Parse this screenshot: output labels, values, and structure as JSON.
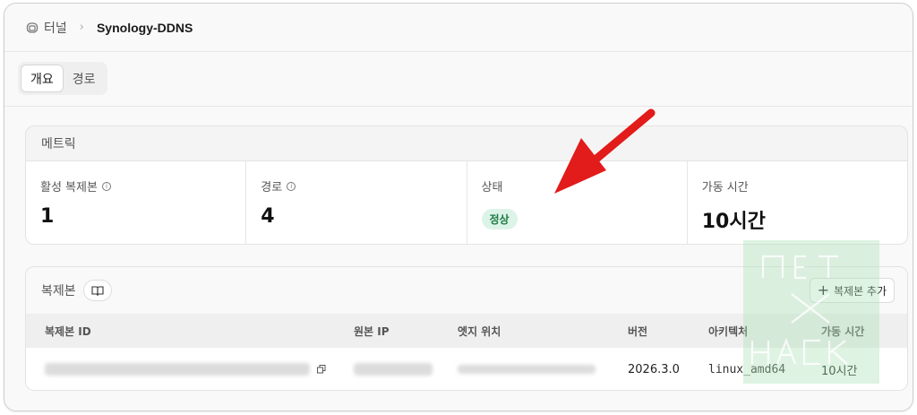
{
  "breadcrumb": {
    "parent": "터널",
    "current": "Synology-DDNS"
  },
  "tabs": [
    {
      "label": "개요",
      "active": true
    },
    {
      "label": "경로",
      "active": false
    }
  ],
  "metrics": {
    "title": "메트릭",
    "items": [
      {
        "label": "활성 복제본",
        "value": "1",
        "info": true
      },
      {
        "label": "경로",
        "value": "4",
        "info": true
      },
      {
        "label": "상태",
        "badge": "정상"
      },
      {
        "label": "가동 시간",
        "value": "10시간"
      }
    ]
  },
  "replicas": {
    "title": "복제본",
    "add_label": "복제본 추가",
    "columns": [
      "복제본 ID",
      "원본 IP",
      "엣지 위치",
      "버전",
      "아키텍처",
      "가동 시간"
    ],
    "rows": [
      {
        "id": "",
        "ip": "",
        "edge": "",
        "version": "2026.3.0",
        "arch": "linux_amd64",
        "uptime": "10시간"
      }
    ]
  },
  "watermark_text": "NET HACK",
  "colors": {
    "accent_arrow": "#e21b1b",
    "status_green": "#1f7a44",
    "status_bg": "#dcf4e7"
  }
}
